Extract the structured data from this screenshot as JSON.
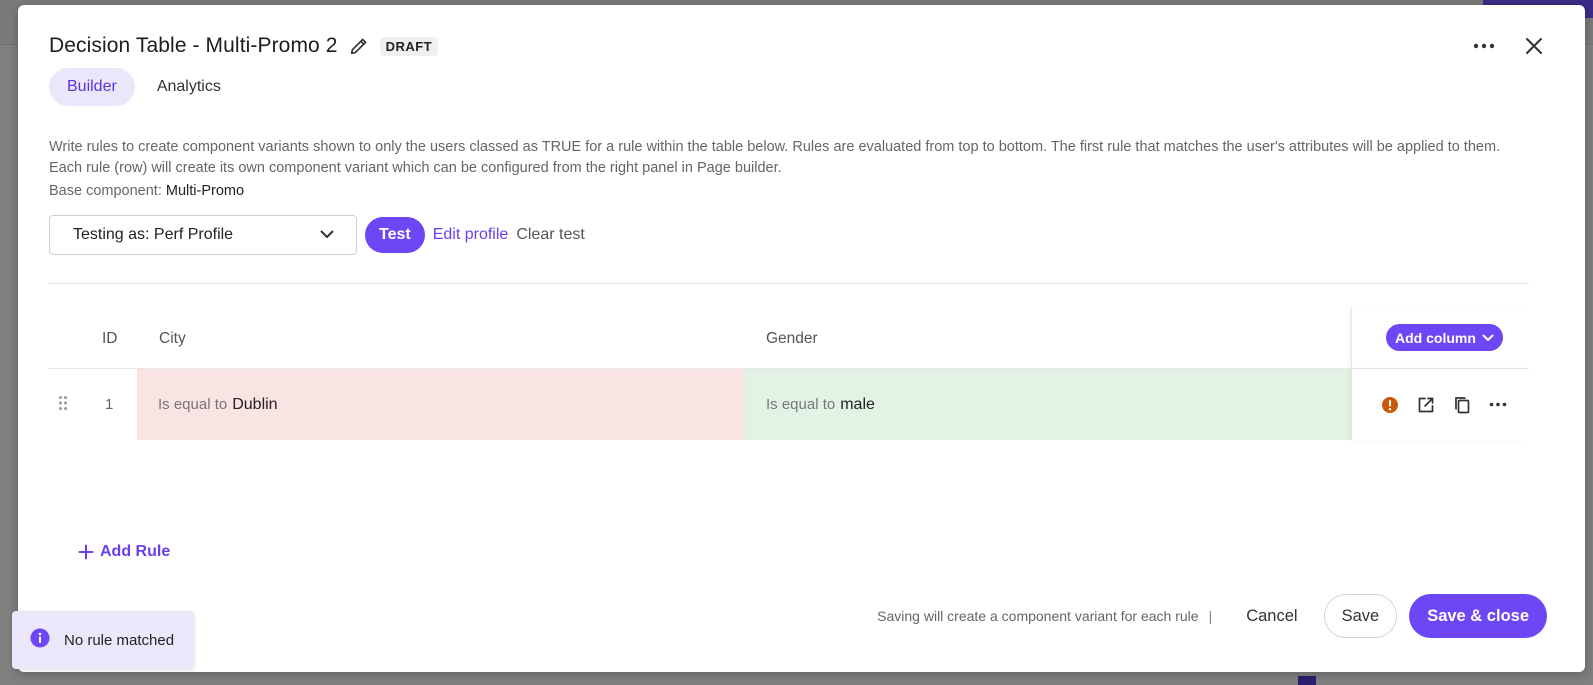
{
  "modal": {
    "title": "Decision Table - Multi-Promo 2",
    "status_badge": "DRAFT",
    "tabs": [
      {
        "label": "Builder",
        "active": true
      },
      {
        "label": "Analytics",
        "active": false
      }
    ],
    "description": "Write rules to create component variants shown to only the users classed as TRUE for a rule within the table below. Rules are evaluated from top to bottom. The first rule that matches the user's attributes will be applied to them. Each rule (row) will create its own component variant which can be configured from the right panel in Page builder.",
    "base_component_label": "Base component:",
    "base_component_value": "Multi-Promo"
  },
  "testing": {
    "selected_profile": "Testing as: Perf Profile",
    "test_button": "Test",
    "edit_profile_link": "Edit profile",
    "clear_test_link": "Clear test"
  },
  "table": {
    "headers": {
      "id": "ID",
      "city": "City",
      "gender": "Gender"
    },
    "add_column_button": "Add column",
    "rows": [
      {
        "id": "1",
        "city": {
          "operator": "Is equal to",
          "value": "Dublin",
          "status": "unmatched"
        },
        "gender": {
          "operator": "Is equal to",
          "value": "male",
          "status": "matched"
        }
      }
    ]
  },
  "add_rule_button": "Add Rule",
  "footer": {
    "note": "Saving will create a component variant for each rule",
    "separator": "|",
    "cancel": "Cancel",
    "save": "Save",
    "save_close": "Save & close"
  },
  "toast": {
    "message": "No rule matched"
  },
  "colors": {
    "accent": "#6d47f5",
    "unmatched_cell": "#fae3e3",
    "matched_cell": "#e2f3e6",
    "warning": "#c85a0a"
  },
  "icons": [
    "pencil-icon",
    "more-horizontal-icon",
    "close-icon",
    "chevron-down-icon",
    "drag-handle-icon",
    "warning-icon",
    "open-external-icon",
    "copy-icon",
    "plus-icon",
    "info-icon"
  ]
}
